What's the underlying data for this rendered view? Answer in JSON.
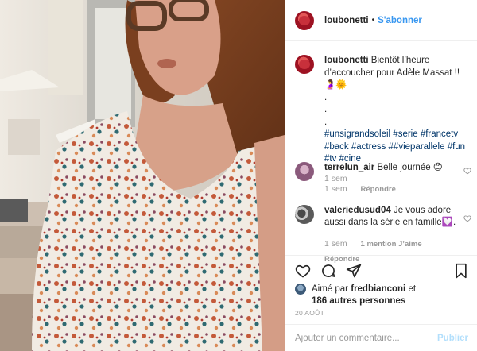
{
  "header": {
    "username": "loubonetti",
    "separator": "•",
    "follow_label": "S'abonner"
  },
  "caption": {
    "username": "loubonetti",
    "text": "Bientôt l’heure d’accoucher pour Adèle Massat !! 🤰🌞",
    "dots": [
      ".",
      ".",
      "."
    ],
    "hashtags": "#unsigrandsoleil #serie #francetv #back #actress ##vieparallele #fun #tv #cine",
    "time": "1 sem"
  },
  "comments": [
    {
      "username": "terrelun_air",
      "text": "Belle journée 😊",
      "time": "1 sem",
      "reply_label": "Répondre",
      "likes_label": ""
    },
    {
      "username": "valeriedusud04",
      "text": "Je vous adore aussi dans la série en famille💟.",
      "time": "1 sem",
      "likes_label": "1 mention J’aime",
      "reply_label": "Répondre"
    }
  ],
  "likes": {
    "prefix": "Aimé par",
    "user": "fredbianconi",
    "suffix": "et",
    "others": "186 autres personnes"
  },
  "date": "20 AOÛT",
  "add_comment": {
    "placeholder": "Ajouter un commentaire...",
    "publish_label": "Publier"
  },
  "icons": {
    "like": "heart-icon",
    "comment": "comment-icon",
    "share": "share-icon",
    "save": "bookmark-icon"
  },
  "colors": {
    "link_blue": "#3897f0",
    "hashtag_blue": "#003569",
    "muted": "#999999",
    "publish_disabled": "#b2dffc"
  }
}
